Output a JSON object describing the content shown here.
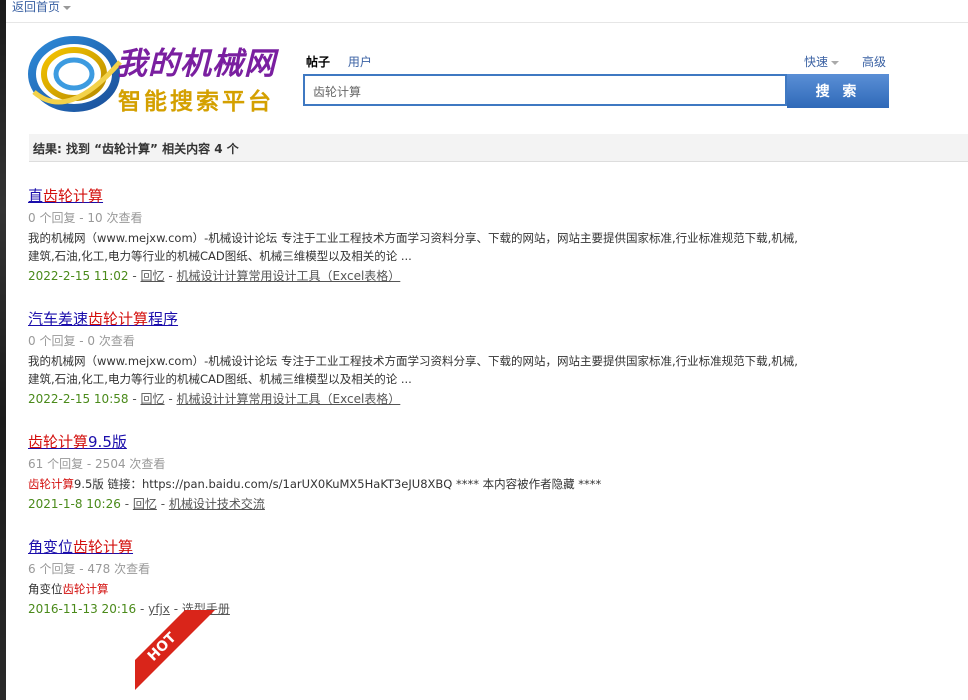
{
  "topbar": {
    "home_label": "返回首页"
  },
  "logo": {
    "line1": "我的机械网",
    "line2": "智能搜索平台"
  },
  "search": {
    "tabs": [
      "帖子",
      "用户"
    ],
    "quick_label": "快速",
    "advanced_label": "高级",
    "query": "齿轮计算",
    "button_label": "搜 索"
  },
  "summary": "结果: 找到 “齿轮计算” 相关内容 4 个",
  "results": [
    {
      "title_pre": "直",
      "title_hl": "齿轮计算",
      "title_post": "",
      "meta": "0 个回复 - 10 次查看",
      "desc_hl": "",
      "desc": "我的机械网（www.mejxw.com）-机械设计论坛 专注于工业工程技术方面学习资料分享、下载的网站，网站主要提供国家标准,行业标准规范下载,机械,建筑,石油,化工,电力等行业的机械CAD图纸、机械三维模型以及相关的论 ...",
      "date": "2022-2-15 11:02",
      "author": "回忆",
      "forum": "机械设计计算常用设计工具（Excel表格）"
    },
    {
      "title_pre": "汽车差速",
      "title_hl": "齿轮计算",
      "title_post": "程序",
      "meta": "0 个回复 - 0 次查看",
      "desc_hl": "",
      "desc": "我的机械网（www.mejxw.com）-机械设计论坛 专注于工业工程技术方面学习资料分享、下载的网站，网站主要提供国家标准,行业标准规范下载,机械,建筑,石油,化工,电力等行业的机械CAD图纸、机械三维模型以及相关的论 ...",
      "date": "2022-2-15 10:58",
      "author": "回忆",
      "forum": "机械设计计算常用设计工具（Excel表格）"
    },
    {
      "title_pre": "",
      "title_hl": "齿轮计算",
      "title_post": "9.5版",
      "meta": "61 个回复 - 2504 次查看",
      "desc_hl": "齿轮计算",
      "desc": "9.5版 链接：https://pan.baidu.com/s/1arUX0KuMX5HaKT3eJU8XBQ **** 本内容被作者隐藏 ****",
      "date": "2021-1-8 10:26",
      "author": "回忆",
      "forum": "机械设计技术交流"
    },
    {
      "title_pre": "角变位",
      "title_hl": "齿轮计算",
      "title_post": "",
      "meta": "6 个回复 - 478 次查看",
      "desc_hl": "齿轮计算",
      "desc_pre": "角变位",
      "desc": "",
      "date": "2016-11-13 20:16",
      "author": "yfjx",
      "forum": "选型手册"
    }
  ],
  "hot_badge": "HOT",
  "colors": {
    "accent": "#3f79c2",
    "highlight": "#d3100e",
    "date_green": "#4a8a1a"
  }
}
